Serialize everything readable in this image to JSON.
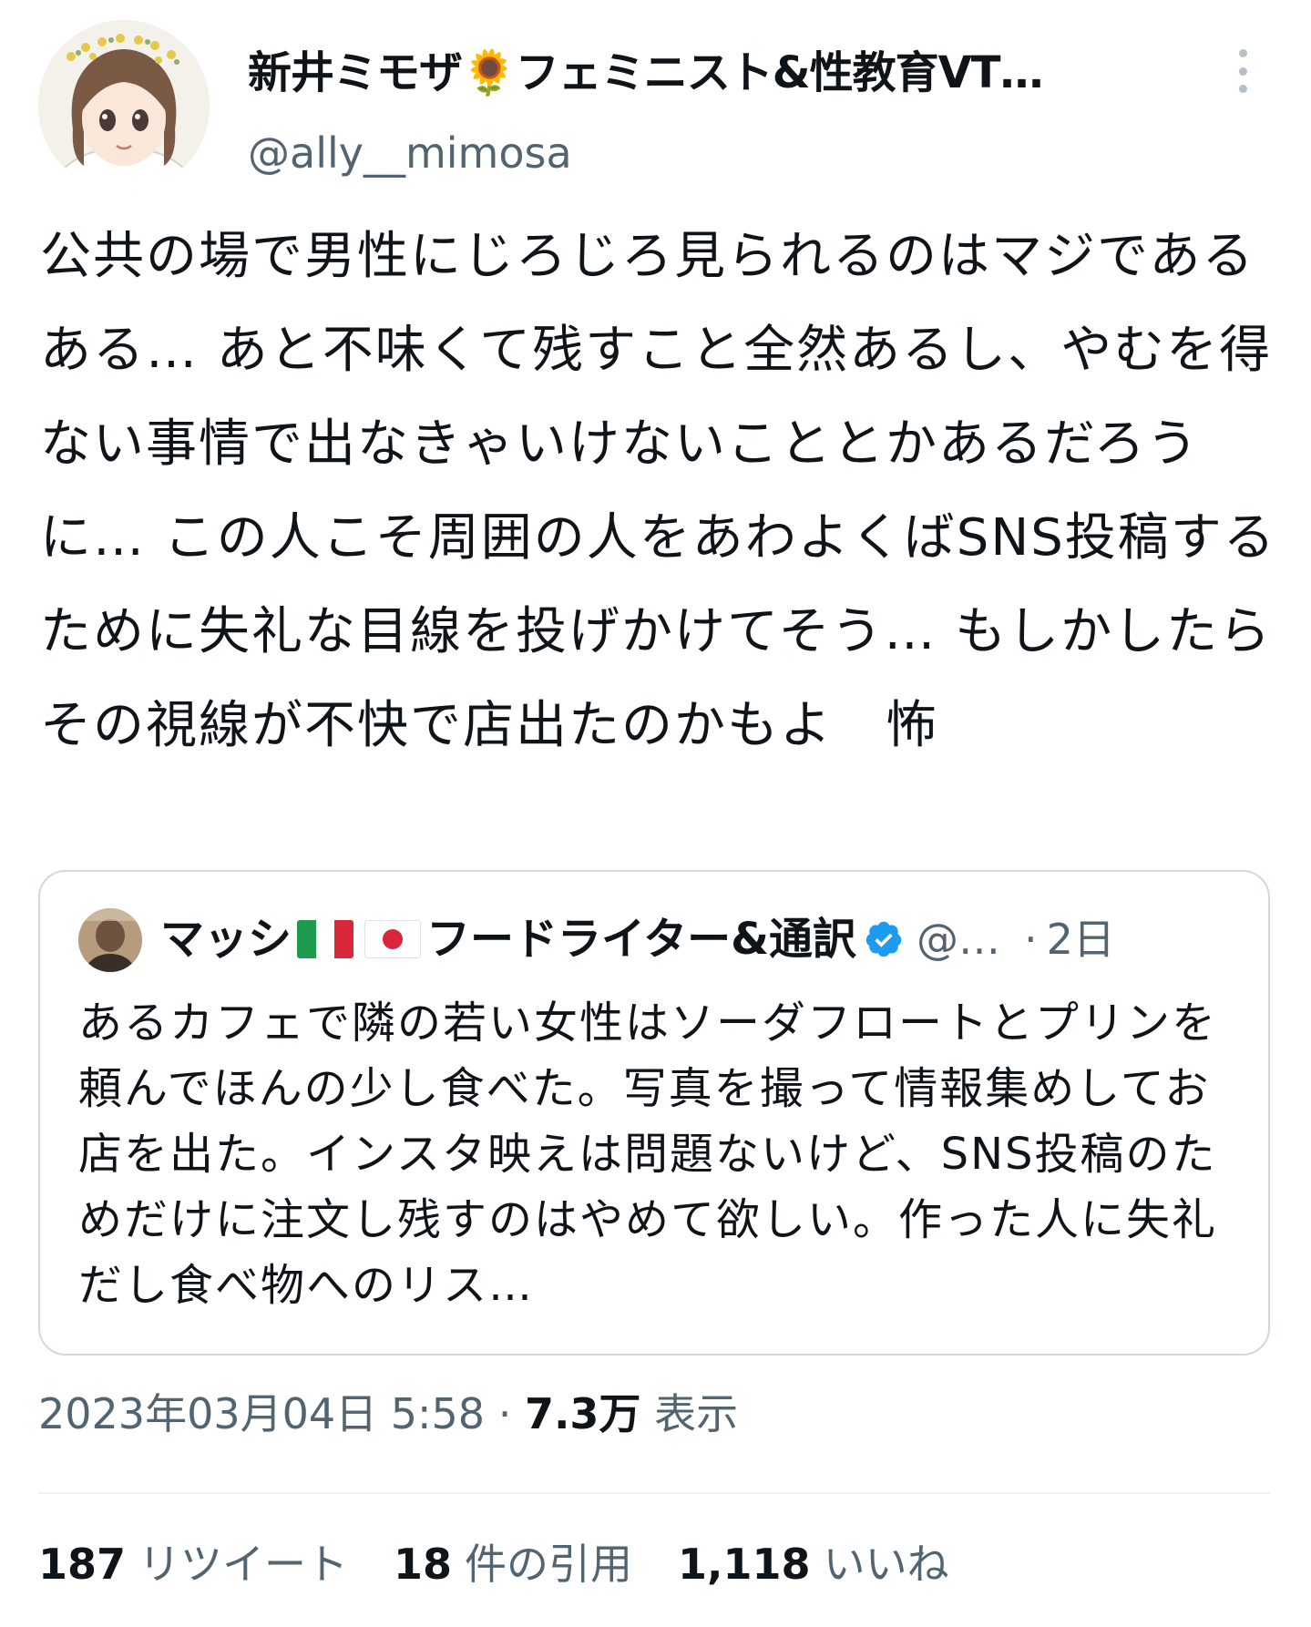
{
  "author": {
    "name": "新井ミモザ🌻フェミニスト&性教育VT…",
    "handle": "@ally__mimosa"
  },
  "icons": {
    "more": "more-vertical-icon",
    "verified": "verified-badge-icon",
    "flag_1": "italy-flag-icon",
    "flag_2": "japan-flag-icon"
  },
  "tweet": {
    "text": "公共の場で男性にじろじろ見られるのはマジであるある… あと不味くて残すこと全然あるし、やむを得ない事情で出なきゃいけないこととかあるだろうに… この人こそ周囲の人をあわよくばSNS投稿するために失礼な目線を投げかけてそう… もしかしたらその視線が不快で店出たのかもよ　怖"
  },
  "quoted": {
    "name": "マッシ",
    "name_suffix": "フードライター&通訳",
    "handle": "@…",
    "separator": "·",
    "time": "2日",
    "text": "あるカフェで隣の若い女性はソーダフロートとプリンを頼んでほんの少し食べた。写真を撮って情報集めしてお店を出た。インスタ映えは問題ないけど、SNS投稿のためだけに注文し残すのはやめて欲しい。作った人に失礼だし食べ物へのリス…",
    "flag_colors": {
      "italy": [
        "#1e9b4f",
        "#ffffff",
        "#d8283a"
      ],
      "japan_circle": "#d8263a"
    }
  },
  "meta": {
    "timestamp": "2023年03月04日 5:58",
    "separator": "·",
    "views_count": "7.3万",
    "views_label": "表示"
  },
  "stats": {
    "retweets_count": "187",
    "retweets_label": "リツイート",
    "quotes_count": "18",
    "quotes_label": "件の引用",
    "likes_count": "1,118",
    "likes_label": "いいね"
  },
  "colors": {
    "text_primary": "#0f1419",
    "text_secondary": "#536471",
    "border": "#cfd9de",
    "verified": "#1d9bf0"
  }
}
